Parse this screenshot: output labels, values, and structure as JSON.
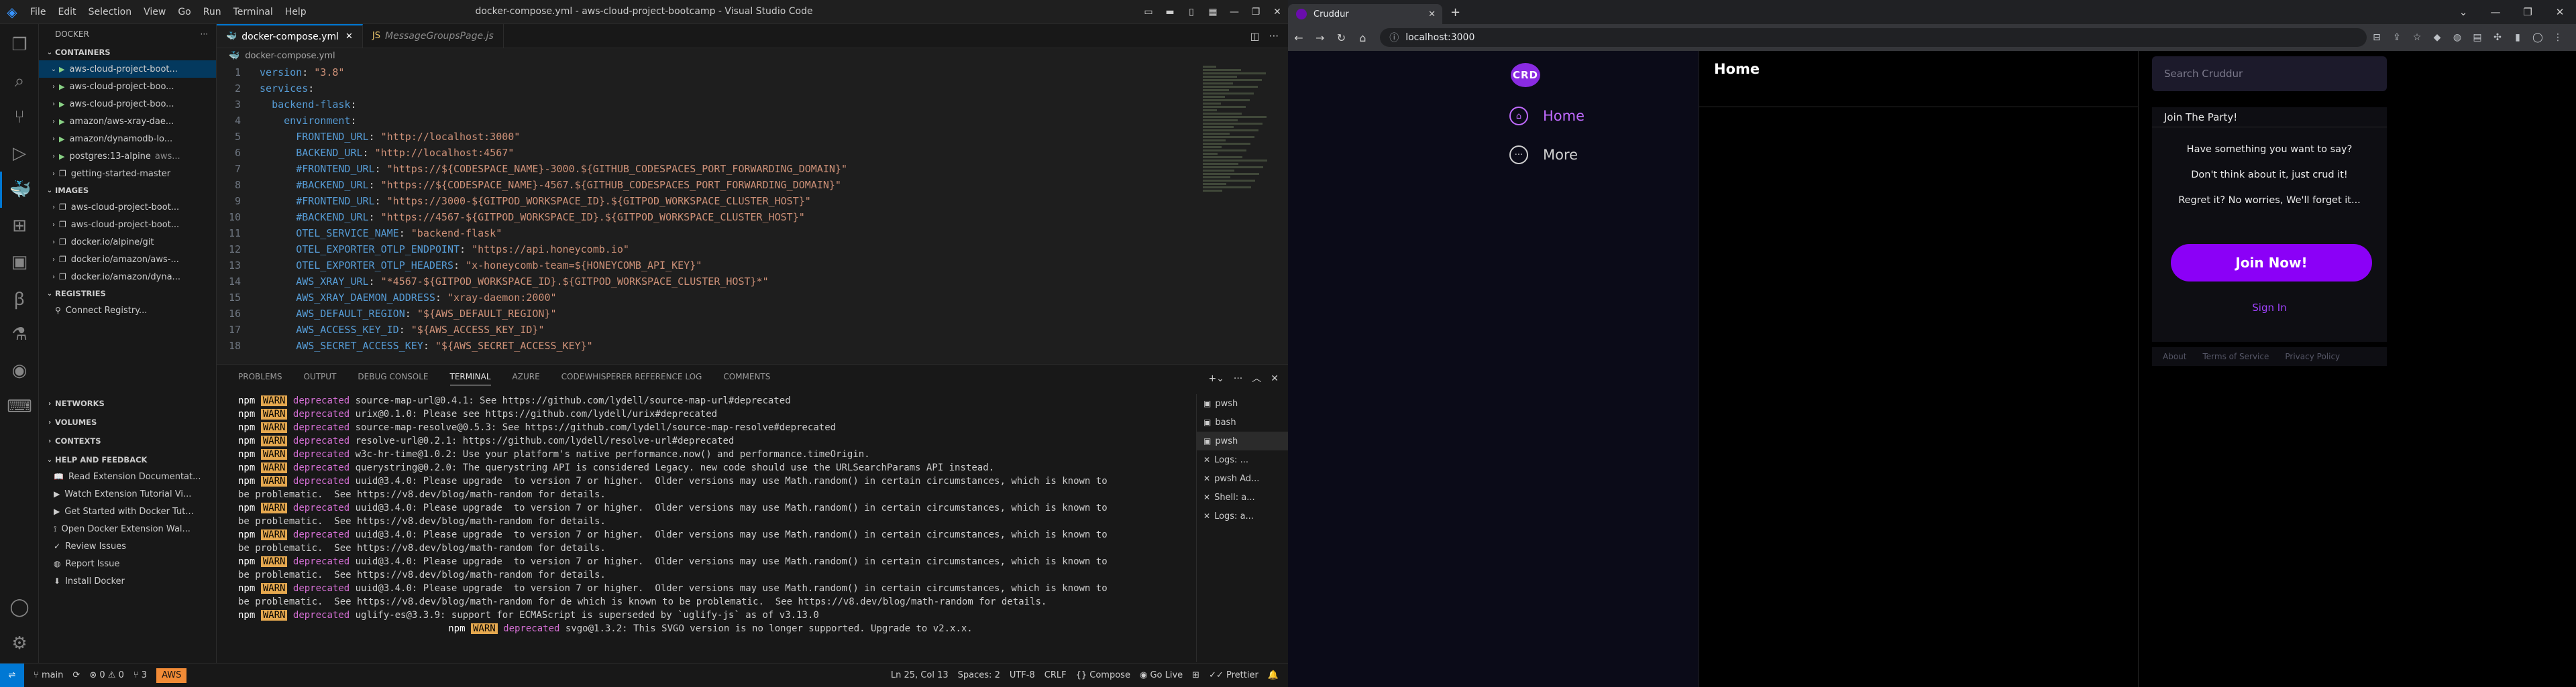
{
  "vscode": {
    "menu": [
      "File",
      "Edit",
      "Selection",
      "View",
      "Go",
      "Run",
      "Terminal",
      "Help"
    ],
    "window_title": "docker-compose.yml - aws-cloud-project-bootcamp - Visual Studio Code",
    "sidebar": {
      "title": "DOCKER",
      "containers_header": "CONTAINERS",
      "containers": [
        {
          "name": "aws-cloud-project-boot...",
          "detail": ""
        },
        {
          "name": "aws-cloud-project-boo...",
          "detail": ""
        },
        {
          "name": "aws-cloud-project-boo...",
          "detail": ""
        },
        {
          "name": "amazon/aws-xray-dae...",
          "detail": ""
        },
        {
          "name": "amazon/dynamodb-lo...",
          "detail": ""
        },
        {
          "name": "postgres:13-alpine",
          "detail": "aws..."
        },
        {
          "name": "getting-started-master",
          "detail": ""
        }
      ],
      "images_header": "IMAGES",
      "images": [
        "aws-cloud-project-boot...",
        "aws-cloud-project-boot...",
        "docker.io/alpine/git",
        "docker.io/amazon/aws-...",
        "docker.io/amazon/dyna..."
      ],
      "registries_header": "REGISTRIES",
      "registries_item": "Connect Registry...",
      "networks": "NETWORKS",
      "volumes": "VOLUMES",
      "contexts": "CONTEXTS",
      "help_header": "HELP AND FEEDBACK",
      "help_items": [
        "Read Extension Documentat...",
        "Watch Extension Tutorial Vi...",
        "Get Started with Docker Tut...",
        "Open Docker Extension Wal...",
        "Review Issues",
        "Report Issue",
        "Install Docker"
      ]
    },
    "tabs": [
      {
        "label": "docker-compose.yml"
      },
      {
        "label": "MessageGroupsPage.js"
      }
    ],
    "breadcrumb": "docker-compose.yml",
    "code": [
      [
        [
          "k",
          "version"
        ],
        [
          "p",
          ": "
        ],
        [
          "s",
          "\"3.8\""
        ]
      ],
      [
        [
          "k",
          "services"
        ],
        [
          "p",
          ":"
        ]
      ],
      [
        [
          "p",
          "  "
        ],
        [
          "k",
          "backend-flask"
        ],
        [
          "p",
          ":"
        ]
      ],
      [
        [
          "p",
          "    "
        ],
        [
          "k",
          "environment"
        ],
        [
          "p",
          ":"
        ]
      ],
      [
        [
          "p",
          "      "
        ],
        [
          "k",
          "FRONTEND_URL"
        ],
        [
          "p",
          ": "
        ],
        [
          "s",
          "\"http://localhost:3000\""
        ]
      ],
      [
        [
          "p",
          "      "
        ],
        [
          "k",
          "BACKEND_URL"
        ],
        [
          "p",
          ": "
        ],
        [
          "s",
          "\"http://localhost:4567\""
        ]
      ],
      [
        [
          "p",
          "      "
        ],
        [
          "k",
          "#FRONTEND_URL"
        ],
        [
          "p",
          ": "
        ],
        [
          "s",
          "\"https://${CODESPACE_NAME}-3000.${GITHUB_CODESPACES_PORT_FORWARDING_DOMAIN}\""
        ]
      ],
      [
        [
          "p",
          "      "
        ],
        [
          "k",
          "#BACKEND_URL"
        ],
        [
          "p",
          ": "
        ],
        [
          "s",
          "\"https://${CODESPACE_NAME}-4567.${GITHUB_CODESPACES_PORT_FORWARDING_DOMAIN}\""
        ]
      ],
      [
        [
          "p",
          "      "
        ],
        [
          "k",
          "#FRONTEND_URL"
        ],
        [
          "p",
          ": "
        ],
        [
          "s",
          "\"https://3000-${GITPOD_WORKSPACE_ID}.${GITPOD_WORKSPACE_CLUSTER_HOST}\""
        ]
      ],
      [
        [
          "p",
          "      "
        ],
        [
          "k",
          "#BACKEND_URL"
        ],
        [
          "p",
          ": "
        ],
        [
          "s",
          "\"https://4567-${GITPOD_WORKSPACE_ID}.${GITPOD_WORKSPACE_CLUSTER_HOST}\""
        ]
      ],
      [
        [
          "p",
          "      "
        ],
        [
          "k",
          "OTEL_SERVICE_NAME"
        ],
        [
          "p",
          ": "
        ],
        [
          "s",
          "\"backend-flask\""
        ]
      ],
      [
        [
          "p",
          "      "
        ],
        [
          "k",
          "OTEL_EXPORTER_OTLP_ENDPOINT"
        ],
        [
          "p",
          ": "
        ],
        [
          "s",
          "\"https://api.honeycomb.io\""
        ]
      ],
      [
        [
          "p",
          "      "
        ],
        [
          "k",
          "OTEL_EXPORTER_OTLP_HEADERS"
        ],
        [
          "p",
          ": "
        ],
        [
          "s",
          "\"x-honeycomb-team=${HONEYCOMB_API_KEY}\""
        ]
      ],
      [
        [
          "p",
          "      "
        ],
        [
          "k",
          "AWS_XRAY_URL"
        ],
        [
          "p",
          ": "
        ],
        [
          "s",
          "\"*4567-${GITPOD_WORKSPACE_ID}.${GITPOD_WORKSPACE_CLUSTER_HOST}*\""
        ]
      ],
      [
        [
          "p",
          "      "
        ],
        [
          "k",
          "AWS_XRAY_DAEMON_ADDRESS"
        ],
        [
          "p",
          ": "
        ],
        [
          "s",
          "\"xray-daemon:2000\""
        ]
      ],
      [
        [
          "p",
          "      "
        ],
        [
          "k",
          "AWS_DEFAULT_REGION"
        ],
        [
          "p",
          ": "
        ],
        [
          "s",
          "\"${AWS_DEFAULT_REGION}\""
        ]
      ],
      [
        [
          "p",
          "      "
        ],
        [
          "k",
          "AWS_ACCESS_KEY_ID"
        ],
        [
          "p",
          ": "
        ],
        [
          "s",
          "\"${AWS_ACCESS_KEY_ID}\""
        ]
      ],
      [
        [
          "p",
          "      "
        ],
        [
          "k",
          "AWS_SECRET_ACCESS_KEY"
        ],
        [
          "p",
          ": "
        ],
        [
          "s",
          "\"${AWS_SECRET_ACCESS_KEY}\""
        ]
      ]
    ],
    "panel_tabs": [
      "PROBLEMS",
      "OUTPUT",
      "DEBUG CONSOLE",
      "TERMINAL",
      "AZURE",
      "CODEWHISPERER REFERENCE LOG",
      "COMMENTS"
    ],
    "active_panel_tab": "TERMINAL",
    "terminal": [
      {
        "pre": "npm",
        "warn": "WARN",
        "dep": "deprecated",
        "text": " source-map-url@0.4.1: See https://github.com/lydell/source-map-url#deprecated"
      },
      {
        "pre": "npm",
        "warn": "WARN",
        "dep": "deprecated",
        "text": " urix@0.1.0: Please see https://github.com/lydell/urix#deprecated"
      },
      {
        "pre": "npm",
        "warn": "WARN",
        "dep": "deprecated",
        "text": " source-map-resolve@0.5.3: See https://github.com/lydell/source-map-resolve#deprecated"
      },
      {
        "pre": "npm",
        "warn": "WARN",
        "dep": "deprecated",
        "text": " resolve-url@0.2.1: https://github.com/lydell/resolve-url#deprecated"
      },
      {
        "pre": "npm",
        "warn": "WARN",
        "dep": "deprecated",
        "text": " w3c-hr-time@1.0.2: Use your platform's native performance.now() and performance.timeOrigin."
      },
      {
        "pre": "npm",
        "warn": "WARN",
        "dep": "deprecated",
        "text": " querystring@0.2.0: The querystring API is considered Legacy. new code should use the URLSearchParams API instead."
      },
      {
        "pre": "npm",
        "warn": "WARN",
        "dep": "deprecated",
        "text": " uuid@3.4.0: Please upgrade  to version 7 or higher.  Older versions may use Math.random() in certain circumstances, which is known to"
      },
      {
        "pre": "",
        "warn": "",
        "dep": "",
        "text": "be problematic.  See https://v8.dev/blog/math-random for details."
      },
      {
        "pre": "npm",
        "warn": "WARN",
        "dep": "deprecated",
        "text": " uuid@3.4.0: Please upgrade  to version 7 or higher.  Older versions may use Math.random() in certain circumstances, which is known to"
      },
      {
        "pre": "",
        "warn": "",
        "dep": "",
        "text": "be problematic.  See https://v8.dev/blog/math-random for details."
      },
      {
        "pre": "npm",
        "warn": "WARN",
        "dep": "deprecated",
        "text": " uuid@3.4.0: Please upgrade  to version 7 or higher.  Older versions may use Math.random() in certain circumstances, which is known to"
      },
      {
        "pre": "",
        "warn": "",
        "dep": "",
        "text": "be problematic.  See https://v8.dev/blog/math-random for details."
      },
      {
        "pre": "npm",
        "warn": "WARN",
        "dep": "deprecated",
        "text": " uuid@3.4.0: Please upgrade  to version 7 or higher.  Older versions may use Math.random() in certain circumstances, which is known to"
      },
      {
        "pre": "",
        "warn": "",
        "dep": "",
        "text": "be problematic.  See https://v8.dev/blog/math-random for details."
      },
      {
        "pre": "npm",
        "warn": "WARN",
        "dep": "deprecated",
        "text": " uuid@3.4.0: Please upgrade  to version 7 or higher.  Older versions may use Math.random() in certain circumstances, which is known to"
      },
      {
        "pre": "",
        "warn": "",
        "dep": "",
        "text": "be problematic.  See https://v8.dev/blog/math-random for de which is known to be problematic.  See https://v8.dev/blog/math-random for details."
      },
      {
        "pre": "npm",
        "warn": "WARN",
        "dep": "deprecated",
        "text": " uglify-es@3.3.9: support for ECMAScript is superseded by `uglify-js` as of v3.13.0"
      },
      {
        "pre": "npm",
        "warn": "WARN",
        "dep": "deprecated",
        "text": " svgo@1.3.2: This SVGO version is no longer supported. Upgrade to v2.x.x.",
        "center": true
      }
    ],
    "terminal_list": [
      "pwsh",
      "bash",
      "pwsh",
      "Logs: ...",
      "pwsh  Ad...",
      "Shell: a...",
      "Logs: a..."
    ],
    "status": {
      "branch": "main",
      "errors": "0",
      "warnings": "0",
      "ports": "3",
      "aws": "AWS",
      "position": "Ln 25, Col 13",
      "spaces": "Spaces: 2",
      "encoding": "UTF-8",
      "eol": "CRLF",
      "compose": "Compose",
      "golive": "Go Live",
      "prettier": "Prettier"
    }
  },
  "browser": {
    "tab_title": "Cruddur",
    "url": "localhost:3000",
    "logo_text": "CRD",
    "nav": [
      "Home",
      "More"
    ],
    "page_title": "Home",
    "search_placeholder": "Search Cruddur",
    "card_title": "Join The Party!",
    "card_lines": [
      "Have something you want to say?",
      "Don't think about it, just crud it!",
      "Regret it? No worries, We'll forget it..."
    ],
    "join_button": "Join Now!",
    "signin": "Sign In",
    "footer": [
      "About",
      "Terms of Service",
      "Privacy Policy"
    ],
    "accent": "#8b00f7"
  }
}
